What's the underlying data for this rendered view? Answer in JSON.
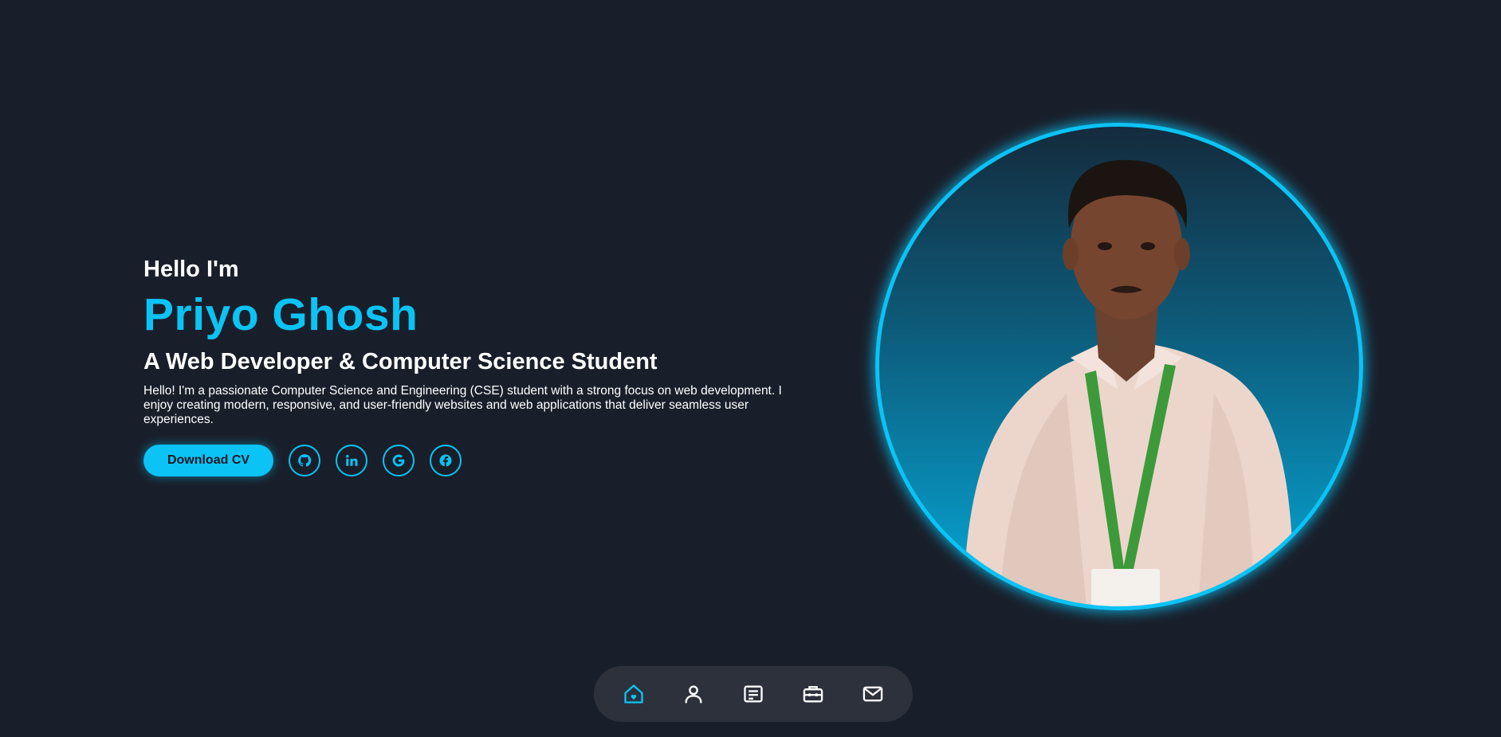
{
  "hero": {
    "greeting": "Hello I'm",
    "name": "Priyo Ghosh",
    "role": "A Web Developer & Computer Science Student",
    "bio": "Hello! I'm a passionate Computer Science and Engineering (CSE) student with a strong focus on web development. I enjoy creating modern, responsive, and user-friendly websites and web applications that deliver seamless user experiences.",
    "download_label": "Download CV",
    "socials": [
      {
        "icon": "github-icon"
      },
      {
        "icon": "linkedin-icon"
      },
      {
        "icon": "google-icon"
      },
      {
        "icon": "facebook-icon"
      }
    ]
  },
  "portrait": {
    "subject": "portrait-photo"
  },
  "nav": {
    "items": [
      {
        "icon": "home-icon",
        "active": true
      },
      {
        "icon": "user-icon",
        "active": false
      },
      {
        "icon": "document-icon",
        "active": false
      },
      {
        "icon": "briefcase-icon",
        "active": false
      },
      {
        "icon": "mail-icon",
        "active": false
      }
    ]
  },
  "colors": {
    "background": "#191f2a",
    "accent": "#0bc3f5",
    "text": "#ffffff",
    "dock": "#2c313c"
  }
}
